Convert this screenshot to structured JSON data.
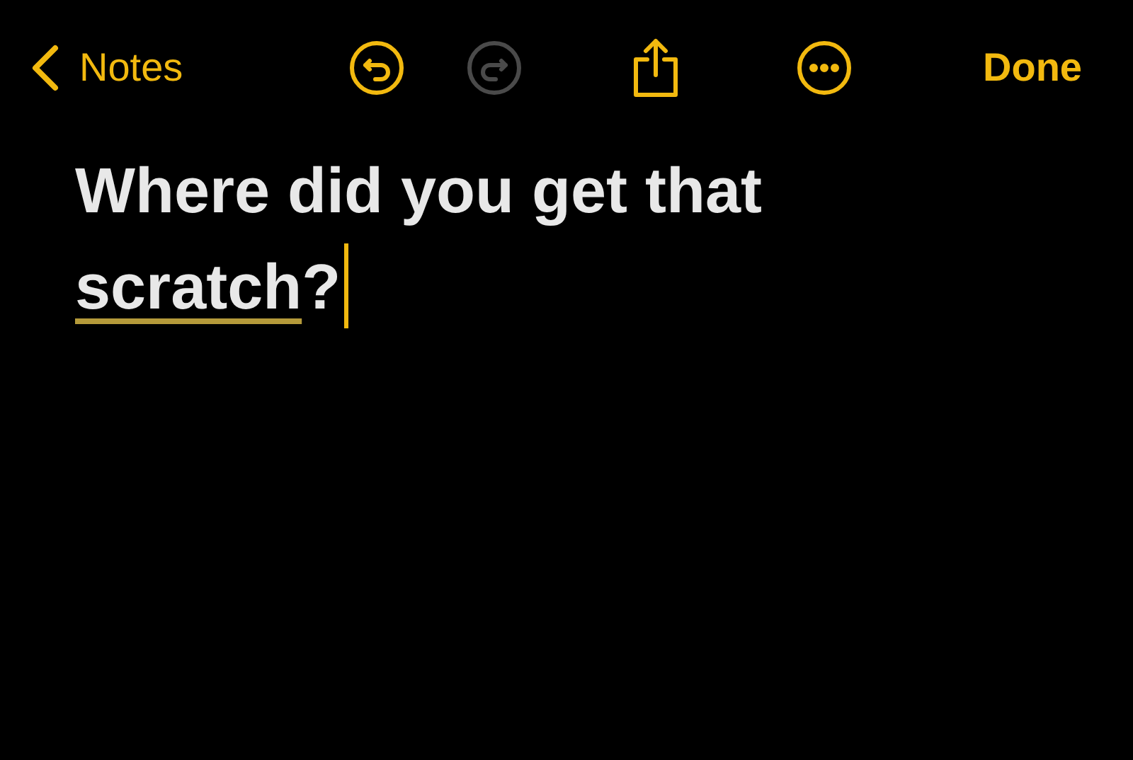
{
  "nav": {
    "back_label": "Notes",
    "undo": {
      "disabled": false
    },
    "redo": {
      "disabled": true
    },
    "done_label": "Done"
  },
  "note": {
    "segments": [
      {
        "text": "Where did you get that ",
        "underlined": false
      },
      {
        "text": "scratch",
        "underlined": true
      },
      {
        "text": "?",
        "underlined": false
      }
    ]
  }
}
